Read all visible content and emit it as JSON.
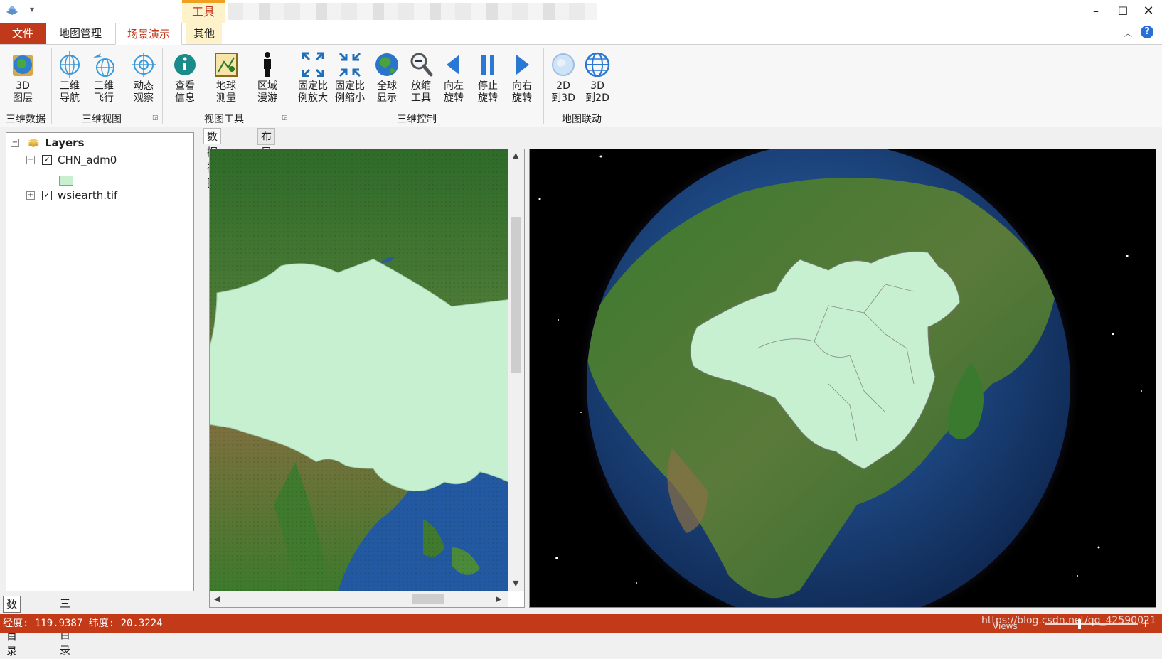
{
  "titlebar": {
    "context_tab": "工具",
    "minimize": "–",
    "maximize": "☐",
    "close": "✕",
    "quick_access": "▾"
  },
  "tabs": [
    {
      "label": "文件"
    },
    {
      "label": "地图管理"
    },
    {
      "label": "场景演示"
    },
    {
      "label": "其他"
    }
  ],
  "ribbon": {
    "collapse": "︿",
    "help": "?",
    "buttons": [
      {
        "label": "3D\n图层",
        "icon": "globe-layer-icon"
      },
      {
        "label": "三维\n导航",
        "icon": "navigation-globe-icon"
      },
      {
        "label": "三维\n飞行",
        "icon": "flight-globe-icon"
      },
      {
        "label": "动态\n观察",
        "icon": "orbit-target-icon"
      },
      {
        "label": "查看\n信息",
        "icon": "info-icon"
      },
      {
        "label": "地球\n测量",
        "icon": "measure-icon"
      },
      {
        "label": "区域\n漫游",
        "icon": "person-icon"
      },
      {
        "label": "固定比\n例放大",
        "icon": "expand-arrows-icon"
      },
      {
        "label": "固定比\n例缩小",
        "icon": "shrink-arrows-icon"
      },
      {
        "label": "全球\n显示",
        "icon": "earth-icon"
      },
      {
        "label": "放缩\n工具",
        "icon": "magnifier-icon"
      },
      {
        "label": "向左\n旋转",
        "icon": "rotate-left-icon"
      },
      {
        "label": "停止\n旋转",
        "icon": "pause-icon"
      },
      {
        "label": "向右\n旋转",
        "icon": "rotate-right-icon"
      },
      {
        "label": "2D\n到3D",
        "icon": "2d-to-3d-icon"
      },
      {
        "label": "3D\n到2D",
        "icon": "3d-to-2d-icon"
      }
    ],
    "groups": [
      {
        "label": "三维数据"
      },
      {
        "label": "三维视图"
      },
      {
        "label": "视图工具"
      },
      {
        "label": "三维控制"
      },
      {
        "label": "地图联动"
      }
    ]
  },
  "toc": {
    "root": "Layers",
    "layers": [
      {
        "name": "CHN_adm0",
        "checked": true,
        "expanded": true,
        "swatch": "#c6f0d0"
      },
      {
        "name": "wsiearth.tif",
        "checked": true,
        "expanded": false
      }
    ]
  },
  "left_tabs": [
    "数据目录",
    "三维目录"
  ],
  "view_tabs": [
    "数据视图",
    "布局视图"
  ],
  "colors": {
    "accent": "#c0391b",
    "china_fill": "#c6f0d0",
    "ocean": "#1d4f8f",
    "land": "#3c7a2e"
  },
  "status": {
    "coords": "经度: 119.9387  纬度: 20.3224",
    "watermark": "https://blog.csdn.net/qq_42590021",
    "views": "Views"
  }
}
